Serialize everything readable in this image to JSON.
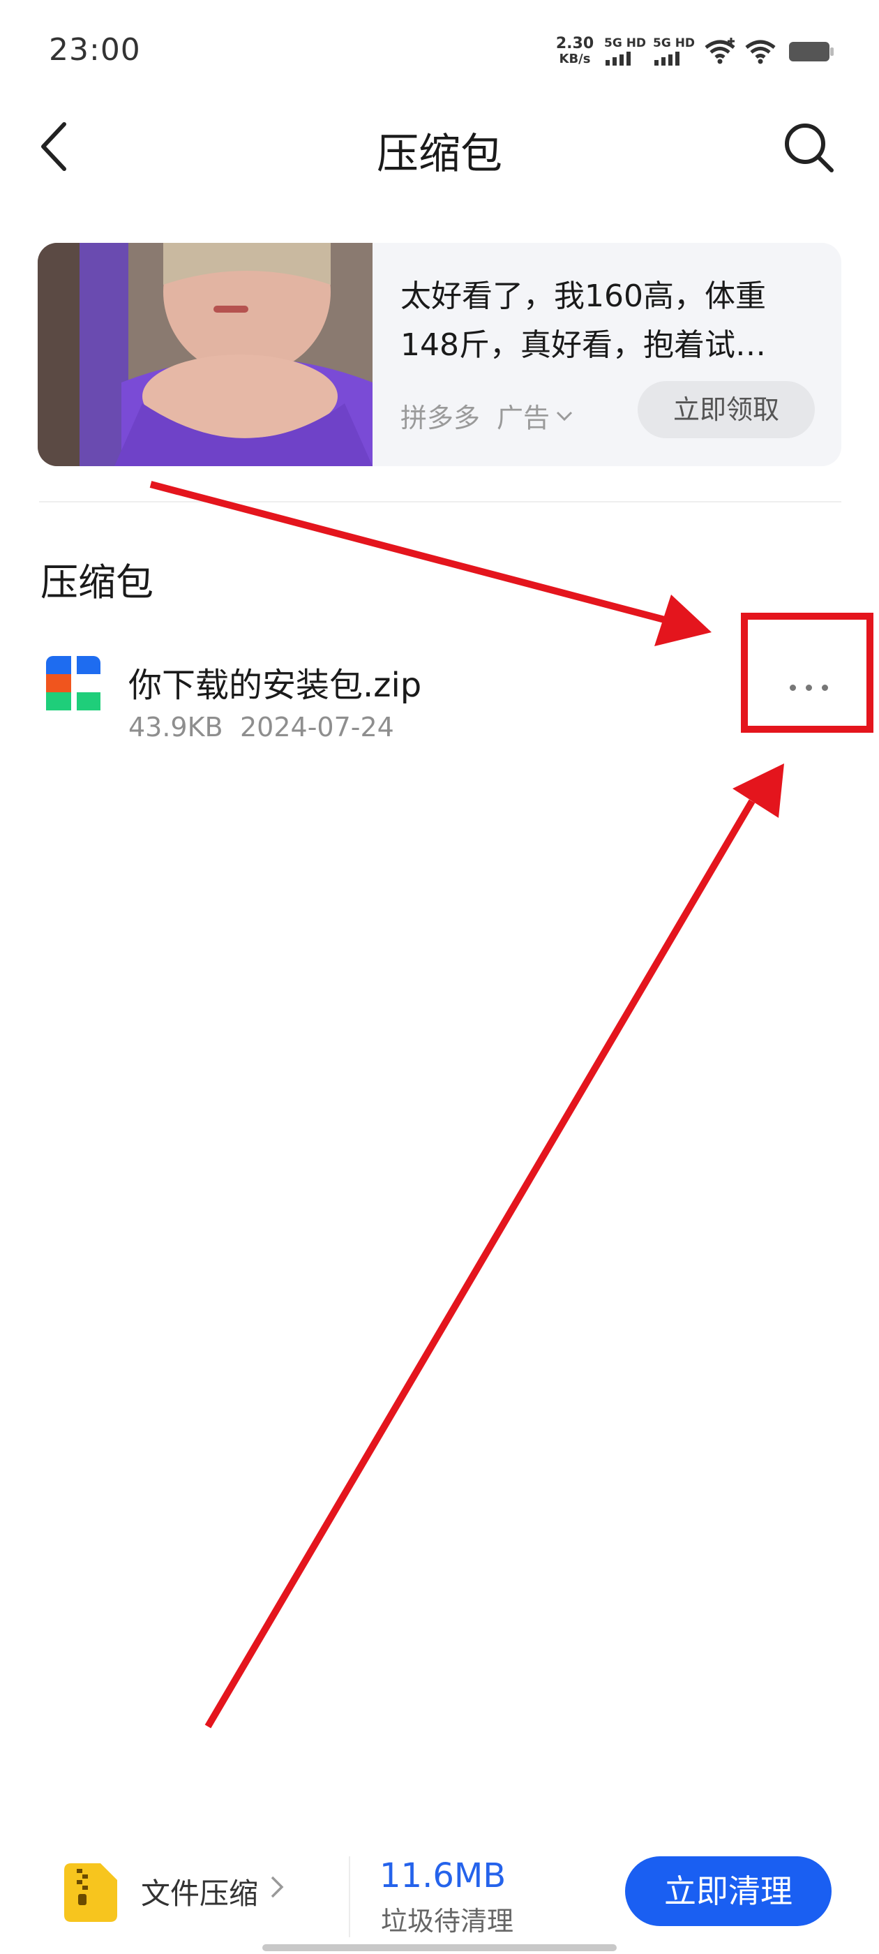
{
  "status_bar": {
    "time": "23:00",
    "net_speed_value": "2.30",
    "net_speed_unit": "KB/s",
    "sim1_label": "5G HD",
    "sim2_label": "5G HD"
  },
  "header": {
    "title": "压缩包",
    "back_icon": "chevron-left-icon",
    "search_icon": "search-icon"
  },
  "ad": {
    "text": "太好看了，我160高，体重148斤，真好看，抱着试…",
    "source": "拼多多",
    "tag": "广告",
    "button_label": "立即领取"
  },
  "section": {
    "title": "压缩包"
  },
  "files": [
    {
      "name": "你下载的安装包.zip",
      "size": "43.9KB",
      "date": "2024-07-24"
    }
  ],
  "bottom_bar": {
    "app_label": "文件压缩",
    "junk_size": "11.6MB",
    "junk_label": "垃圾待清理",
    "clean_button": "立即清理"
  },
  "colors": {
    "accent_blue": "#1a5ff2",
    "annotation_red": "#e4151d"
  }
}
